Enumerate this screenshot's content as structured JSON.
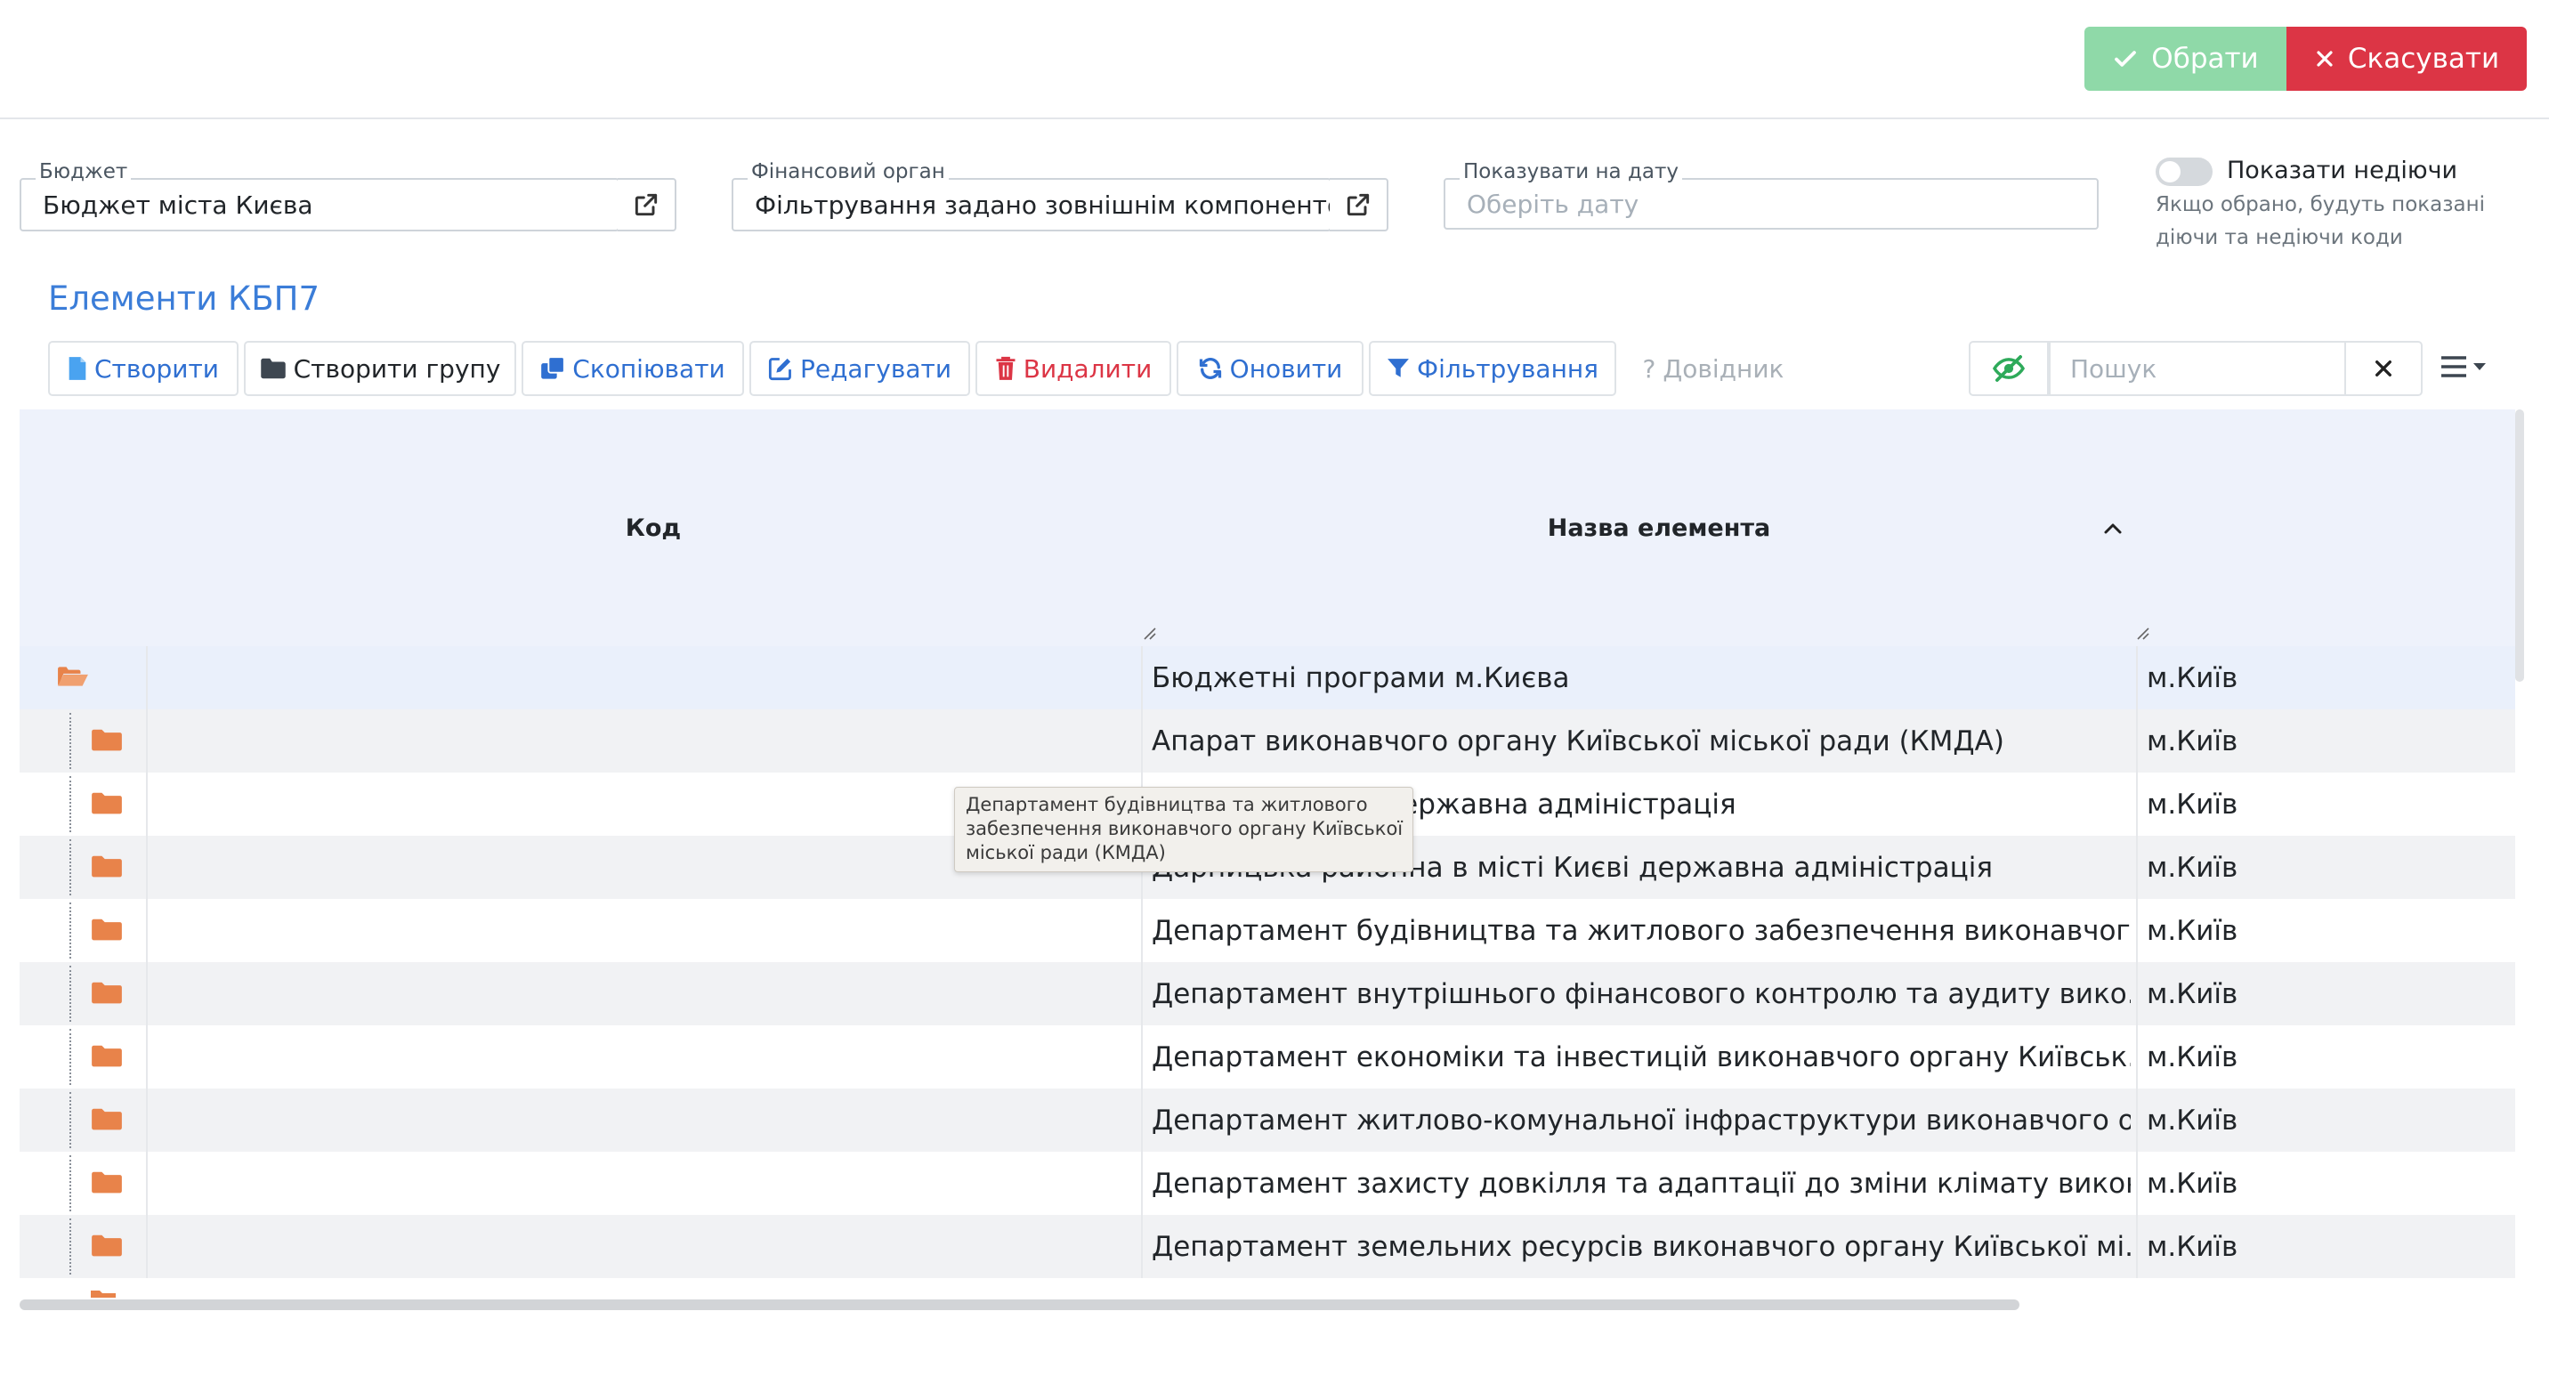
{
  "actions": {
    "ok_label": "Обрати",
    "cancel_label": "Скасувати"
  },
  "fields": {
    "budget": {
      "label": "Бюджет",
      "value": "Бюджет міста Києва"
    },
    "fin_org": {
      "label": "Фінансовий орган",
      "value": "Фільтрування задано зовнішнім компонентом"
    },
    "show_date": {
      "label": "Показувати на дату",
      "placeholder": "Оберіть дату"
    },
    "inactive": {
      "label": "Показати недіючи",
      "hint_line1": "Якщо обрано, будуть показані",
      "hint_line2": "діючи та недіючи коди",
      "checked": false
    }
  },
  "section_title": "Елементи КБП7",
  "toolbar": {
    "create": "Створити",
    "create_group": "Створити групу",
    "copy": "Скопіювати",
    "edit": "Редагувати",
    "delete": "Видалити",
    "refresh": "Оновити",
    "filter": "Фільтрування",
    "reference": "Довідник"
  },
  "search": {
    "placeholder": "Пошук"
  },
  "table": {
    "columns": {
      "code": "Код",
      "name": "Назва елемента"
    },
    "rows": [
      {
        "code": "",
        "name": "Бюджетні програми м.Києва",
        "city": "м.Київ"
      },
      {
        "code": "",
        "name": "Апарат виконавчого органу Київської міської ради (КМДА)",
        "city": "м.Київ"
      },
      {
        "code": "",
        "name": "на в місті Києві державна адміністрація",
        "city": "м.Київ"
      },
      {
        "code": "",
        "name": "Дарницька районна в місті Києві державна адміністрація",
        "city": "м.Київ"
      },
      {
        "code": "",
        "name": "Департамент будівництва та житлового забезпечення виконавчог...",
        "city": "м.Київ"
      },
      {
        "code": "",
        "name": "Департамент внутрішнього фінансового контролю та аудиту вико...",
        "city": "м.Київ"
      },
      {
        "code": "",
        "name": "Департамент економіки та інвестицій виконавчого органу Київськ...",
        "city": "м.Київ"
      },
      {
        "code": "",
        "name": "Департамент житлово-комунальної інфраструктури виконавчого о...",
        "city": "м.Київ"
      },
      {
        "code": "",
        "name": "Департамент захисту довкілля та адаптації до зміни клімату викон...",
        "city": "м.Київ"
      },
      {
        "code": "",
        "name": "Департамент земельних ресурсів виконавчого органу Київської мі...",
        "city": "м.Київ"
      }
    ]
  },
  "tooltip": {
    "line1": "Департамент будівництва та житлового",
    "line2": "забезпечення виконавчого органу Київської",
    "line3": "міської ради (КМДА)"
  },
  "colors": {
    "accent": "#3b7dd8",
    "ok": "#8fd9a8",
    "danger": "#dc3545",
    "folder": "#e8834a",
    "header_bg": "#eef2fb"
  }
}
